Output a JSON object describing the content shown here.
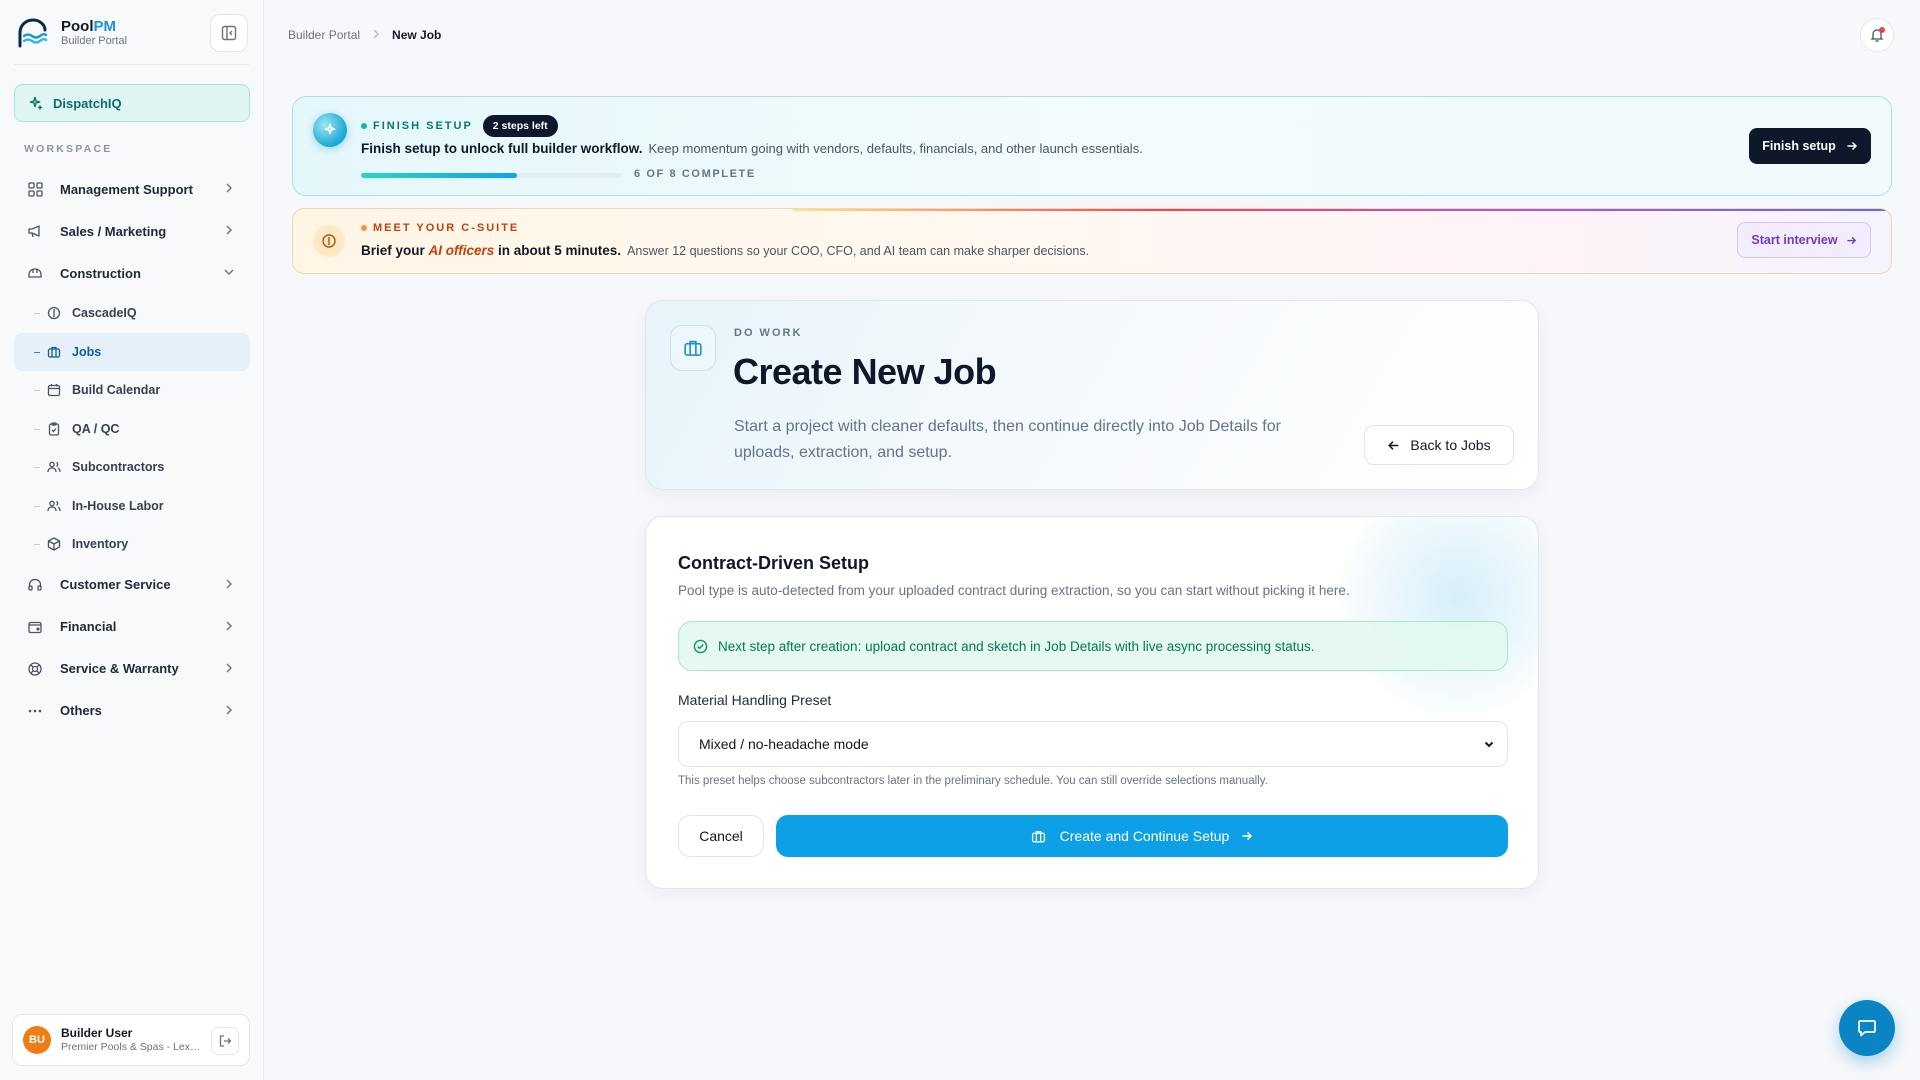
{
  "brand": {
    "name_part1": "Pool",
    "name_part2": "PM",
    "subtitle": "Builder Portal"
  },
  "sidebar": {
    "dispatch_label": "DispatchIQ",
    "workspace_label": "WORKSPACE",
    "items": [
      {
        "label": "Management Support",
        "icon": "grid-icon",
        "expanded": false
      },
      {
        "label": "Sales / Marketing",
        "icon": "megaphone-icon",
        "expanded": false
      },
      {
        "label": "Construction",
        "icon": "hard-hat-icon",
        "expanded": true
      },
      {
        "label": "Customer Service",
        "icon": "headset-icon",
        "expanded": false
      },
      {
        "label": "Financial",
        "icon": "wallet-icon",
        "expanded": false
      },
      {
        "label": "Service & Warranty",
        "icon": "lifebuoy-icon",
        "expanded": false
      },
      {
        "label": "Others",
        "icon": "ellipsis-icon",
        "expanded": false
      }
    ],
    "construction_sub": [
      {
        "label": "CascadeIQ",
        "icon": "cascade-icon"
      },
      {
        "label": "Jobs",
        "icon": "briefcase-icon",
        "active": true
      },
      {
        "label": "Build Calendar",
        "icon": "calendar-icon"
      },
      {
        "label": "QA / QC",
        "icon": "clipboard-check-icon"
      },
      {
        "label": "Subcontractors",
        "icon": "users-icon"
      },
      {
        "label": "In-House Labor",
        "icon": "users-icon"
      },
      {
        "label": "Inventory",
        "icon": "package-icon"
      }
    ]
  },
  "user": {
    "initials": "BU",
    "name": "Builder User",
    "org": "Premier Pools & Spas - Lexington"
  },
  "breadcrumb": {
    "root": "Builder Portal",
    "current": "New Job"
  },
  "setup_banner": {
    "label": "FINISH SETUP",
    "pill": "2 steps left",
    "headline": "Finish setup to unlock full builder workflow.",
    "body": "Keep momentum going with vendors, defaults, financials, and other launch essentials.",
    "progress_fraction": 0.6,
    "progress_text": "6 OF 8 COMPLETE",
    "button": "Finish setup"
  },
  "csuite_banner": {
    "label": "MEET YOUR C-SUITE",
    "lead": "Brief your ",
    "ai": "AI officers",
    "lead_end": " in about 5 minutes.",
    "body": "Answer 12 questions so your COO, CFO, and AI team can make sharper decisions.",
    "button": "Start interview"
  },
  "hero": {
    "kicker": "DO WORK",
    "title": "Create New Job",
    "description": "Start a project with cleaner defaults, then continue directly into Job Details for uploads, extraction, and setup.",
    "back_button": "Back to Jobs"
  },
  "form": {
    "title": "Contract-Driven Setup",
    "subtitle": "Pool type is auto-detected from your uploaded contract during extraction, so you can start without picking it here.",
    "notice": "Next step after creation: upload contract and sketch in Job Details with live async processing status.",
    "field_label": "Material Handling Preset",
    "select_value": "Mixed / no-headache mode",
    "hint": "This preset helps choose subcontractors later in the preliminary schedule. You can still override selections manually.",
    "cancel": "Cancel",
    "create": "Create and Continue Setup"
  },
  "colors": {
    "accent": "#0ea0e6",
    "brand_teal": "#14b8a6",
    "dark": "#0f172a",
    "orange": "#c2410c"
  }
}
